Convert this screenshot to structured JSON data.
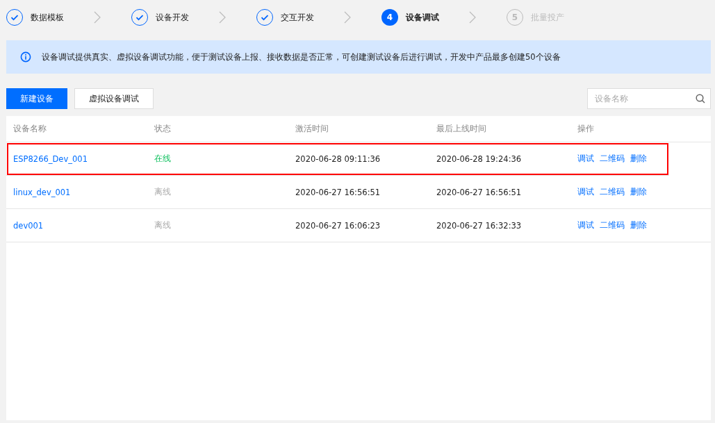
{
  "steps": [
    {
      "label": "数据模板",
      "done": true,
      "current": false
    },
    {
      "label": "设备开发",
      "done": true,
      "current": false
    },
    {
      "label": "交互开发",
      "done": true,
      "current": false
    },
    {
      "number": "4",
      "label": "设备调试",
      "done": false,
      "current": true
    },
    {
      "number": "5",
      "label": "批量投产",
      "done": false,
      "current": false
    }
  ],
  "notice": {
    "text": "设备调试提供真实、虚拟设备调试功能，便于测试设备上报、接收数据是否正常，可创建测试设备后进行调试，开发中产品最多创建50个设备"
  },
  "toolbar": {
    "buttons": [
      {
        "label": "新建设备",
        "kind": "primary"
      },
      {
        "label": "虚拟设备调试",
        "kind": "default"
      }
    ],
    "search": {
      "placeholder": "设备名称"
    }
  },
  "table": {
    "columns": [
      "设备名称",
      "状态",
      "激活时间",
      "最后上线时间",
      "操作"
    ],
    "rows": [
      {
        "name": "ESP8266_Dev_001",
        "status": "在线",
        "online": true,
        "activated": "2020-06-28 09:11:36",
        "last_online": "2020-06-28 19:24:36",
        "actions": [
          "调试",
          "二维码",
          "删除"
        ],
        "highlighted": true
      },
      {
        "name": "linux_dev_001",
        "status": "离线",
        "online": false,
        "activated": "2020-06-27 16:56:51",
        "last_online": "2020-06-27 16:56:51",
        "actions": [
          "调试",
          "二维码",
          "删除"
        ],
        "highlighted": false
      },
      {
        "name": "dev001",
        "status": "离线",
        "online": false,
        "activated": "2020-06-27 16:06:23",
        "last_online": "2020-06-27 16:32:33",
        "actions": [
          "调试",
          "二维码",
          "删除"
        ],
        "highlighted": false
      }
    ]
  }
}
